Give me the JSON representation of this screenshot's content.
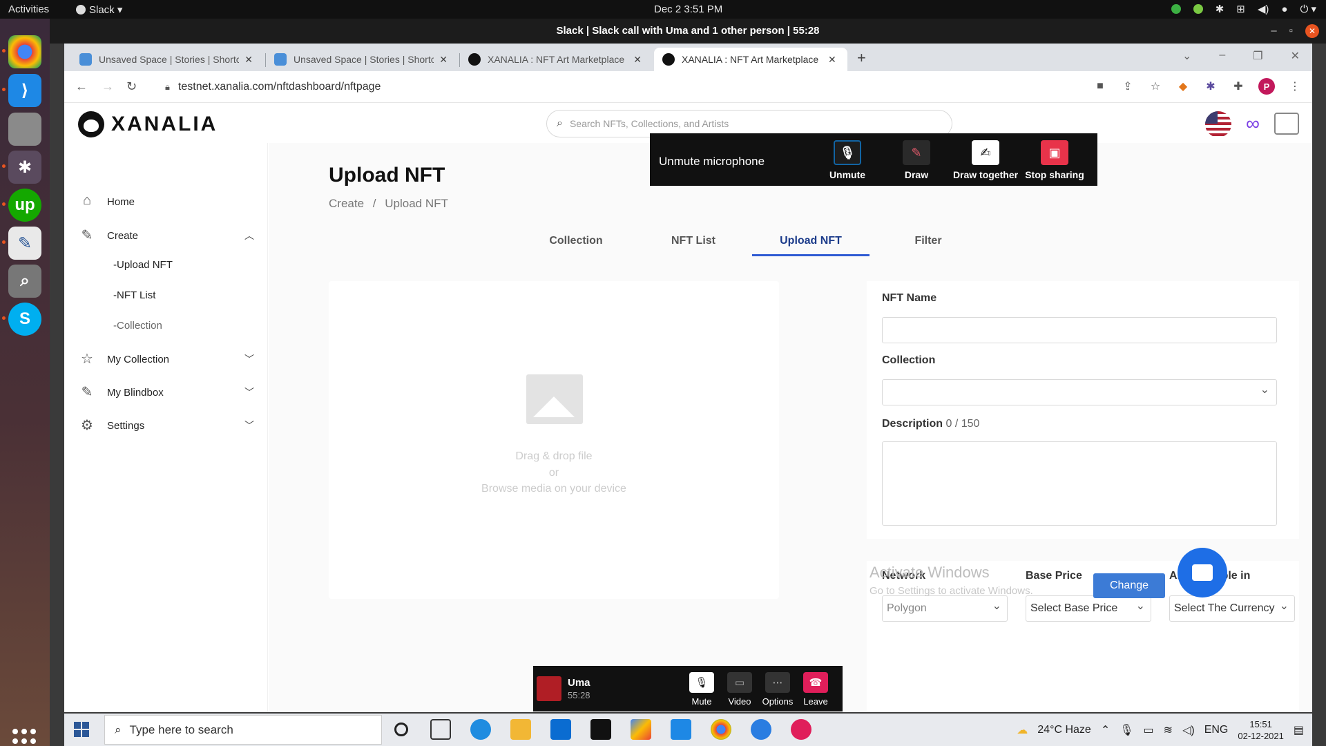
{
  "os_topbar": {
    "activities": "Activities",
    "app_name": "Slack",
    "clock": "Dec 2  3:51 PM"
  },
  "window_title": "Slack | Slack call with Uma and 1 other person | 55:28",
  "browser": {
    "tabs": [
      {
        "label": "Unsaved Space | Stories | Shortc",
        "active": false
      },
      {
        "label": "Unsaved Space | Stories | Shortc",
        "active": false
      },
      {
        "label": "XANALIA : NFT Art Marketplace",
        "active": false
      },
      {
        "label": "XANALIA : NFT Art Marketplace",
        "active": true
      }
    ],
    "url": "testnet.xanalia.com/nftdashboard/nftpage",
    "profile_initial": "P"
  },
  "site": {
    "brand": "XANALIA",
    "search_placeholder": "Search NFTs, Collections, and Artists"
  },
  "sidebar": {
    "home": "Home",
    "create": "Create",
    "create_children": [
      "-Upload NFT",
      "-NFT List",
      "-Collection"
    ],
    "my_collection": "My Collection",
    "my_blindbox": "My Blindbox",
    "settings": "Settings"
  },
  "main": {
    "title": "Upload NFT",
    "breadcrumb": [
      "Create",
      "/",
      "Upload NFT"
    ],
    "tabs": [
      {
        "label": "Collection",
        "active": false
      },
      {
        "label": "NFT List",
        "active": false
      },
      {
        "label": "Upload NFT",
        "active": true
      },
      {
        "label": "Filter",
        "active": false
      }
    ],
    "dropzone": {
      "line1": "Drag & drop file",
      "line2": "or",
      "line3": "Browse media on your device"
    },
    "form": {
      "nft_name_label": "NFT Name",
      "nft_name_value": "",
      "collection_label": "Collection",
      "collection_value": "",
      "description_label": "Description",
      "description_count": "0 / 150",
      "description_value": ""
    },
    "pricing": {
      "network_label": "Network",
      "network_value": "Polygon",
      "base_price_label": "Base Price",
      "base_price_value": "Select Base Price",
      "also_payable_label": "Also payable in",
      "also_payable_value": "Select The Currency",
      "change_button": "Change"
    },
    "watermark": {
      "line1": "Activate Windows",
      "line2": "Go to Settings to activate Windows."
    }
  },
  "slack_popup": {
    "text": "Unmute microphone",
    "buttons": [
      "Unmute",
      "Draw",
      "Draw together",
      "Stop sharing"
    ]
  },
  "slack_callbar": {
    "name": "Uma",
    "duration": "55:28",
    "buttons": [
      "Mute",
      "Video",
      "Options",
      "Leave"
    ]
  },
  "taskbar": {
    "search_placeholder": "Type here to search",
    "weather": "24°C  Haze",
    "lang": "ENG",
    "time": "15:51",
    "date": "02-12-2021"
  },
  "colors": {
    "accent_blue": "#2f5ad3",
    "leave_red": "#e01e5a",
    "stop_sharing_red": "#e8334a",
    "chat_blue": "#1e6ee6"
  }
}
